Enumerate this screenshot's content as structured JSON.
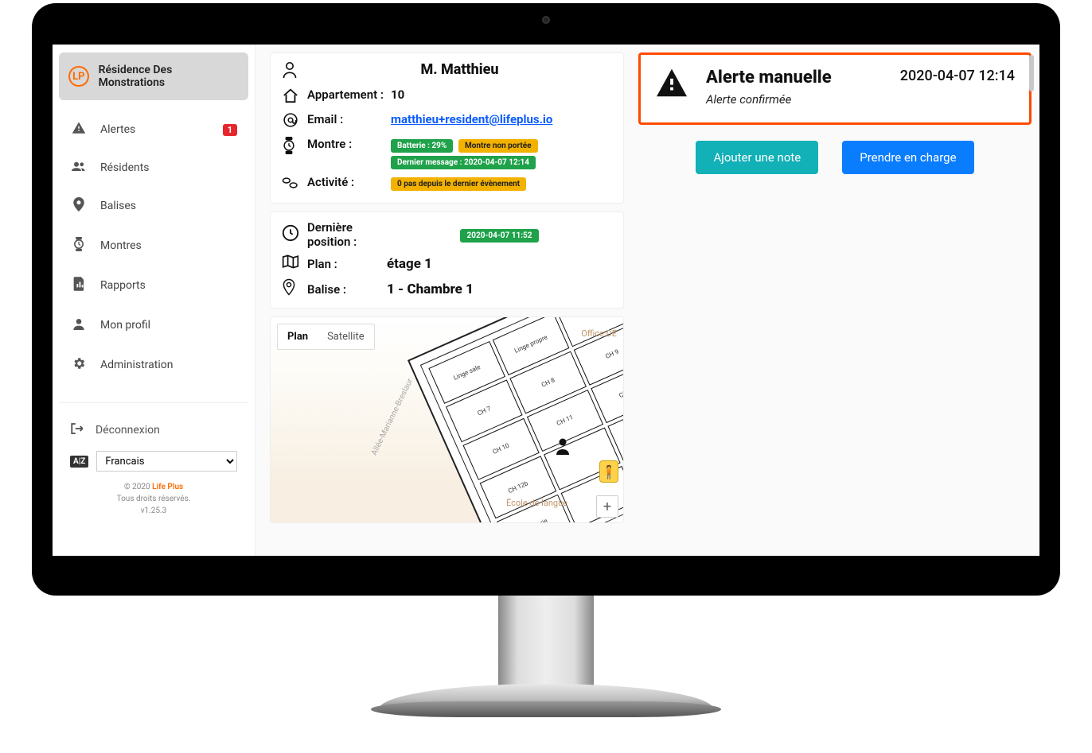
{
  "sidebar": {
    "residence": "Résidence Des Monstrations",
    "items": [
      {
        "label": "Alertes",
        "badge": "1"
      },
      {
        "label": "Résidents"
      },
      {
        "label": "Balises"
      },
      {
        "label": "Montres"
      },
      {
        "label": "Rapports"
      },
      {
        "label": "Mon profil"
      },
      {
        "label": "Administration"
      }
    ],
    "logout": "Déconnexion",
    "language": "Francais",
    "copyright_prefix": "© 2020 ",
    "brand": "Life Plus",
    "rights": "Tous droits réservés.",
    "version": "v1.25.3"
  },
  "resident": {
    "name": "M. Matthieu",
    "apartment_label": "Appartement :",
    "apartment": "10",
    "email_label": "Email :",
    "email": "matthieu+resident@lifeplus.io",
    "watch_label": "Montre :",
    "battery": "Batterie : 29%",
    "watch_status": "Montre non portée",
    "last_msg": "Dernier message : 2020-04-07 12:14",
    "activity_label": "Activité :",
    "activity": "0 pas depuis le dernier évènement"
  },
  "position": {
    "last_pos_label": "Dernière position :",
    "last_pos_time": "2020-04-07 11:52",
    "plan_label": "Plan :",
    "plan": "étage 1",
    "beacon_label": "Balise :",
    "beacon": "1   - Chambre 1"
  },
  "map": {
    "tab_plan": "Plan",
    "tab_sat": "Satellite",
    "label_office": "Office DE",
    "label_street": "Allée-Marianne-Breslaur",
    "label_school": "École de langue"
  },
  "alert": {
    "title": "Alerte manuelle",
    "subtitle": "Alerte confirmée",
    "time": "2020-04-07 12:14",
    "btn_note": "Ajouter une note",
    "btn_take": "Prendre en charge"
  }
}
